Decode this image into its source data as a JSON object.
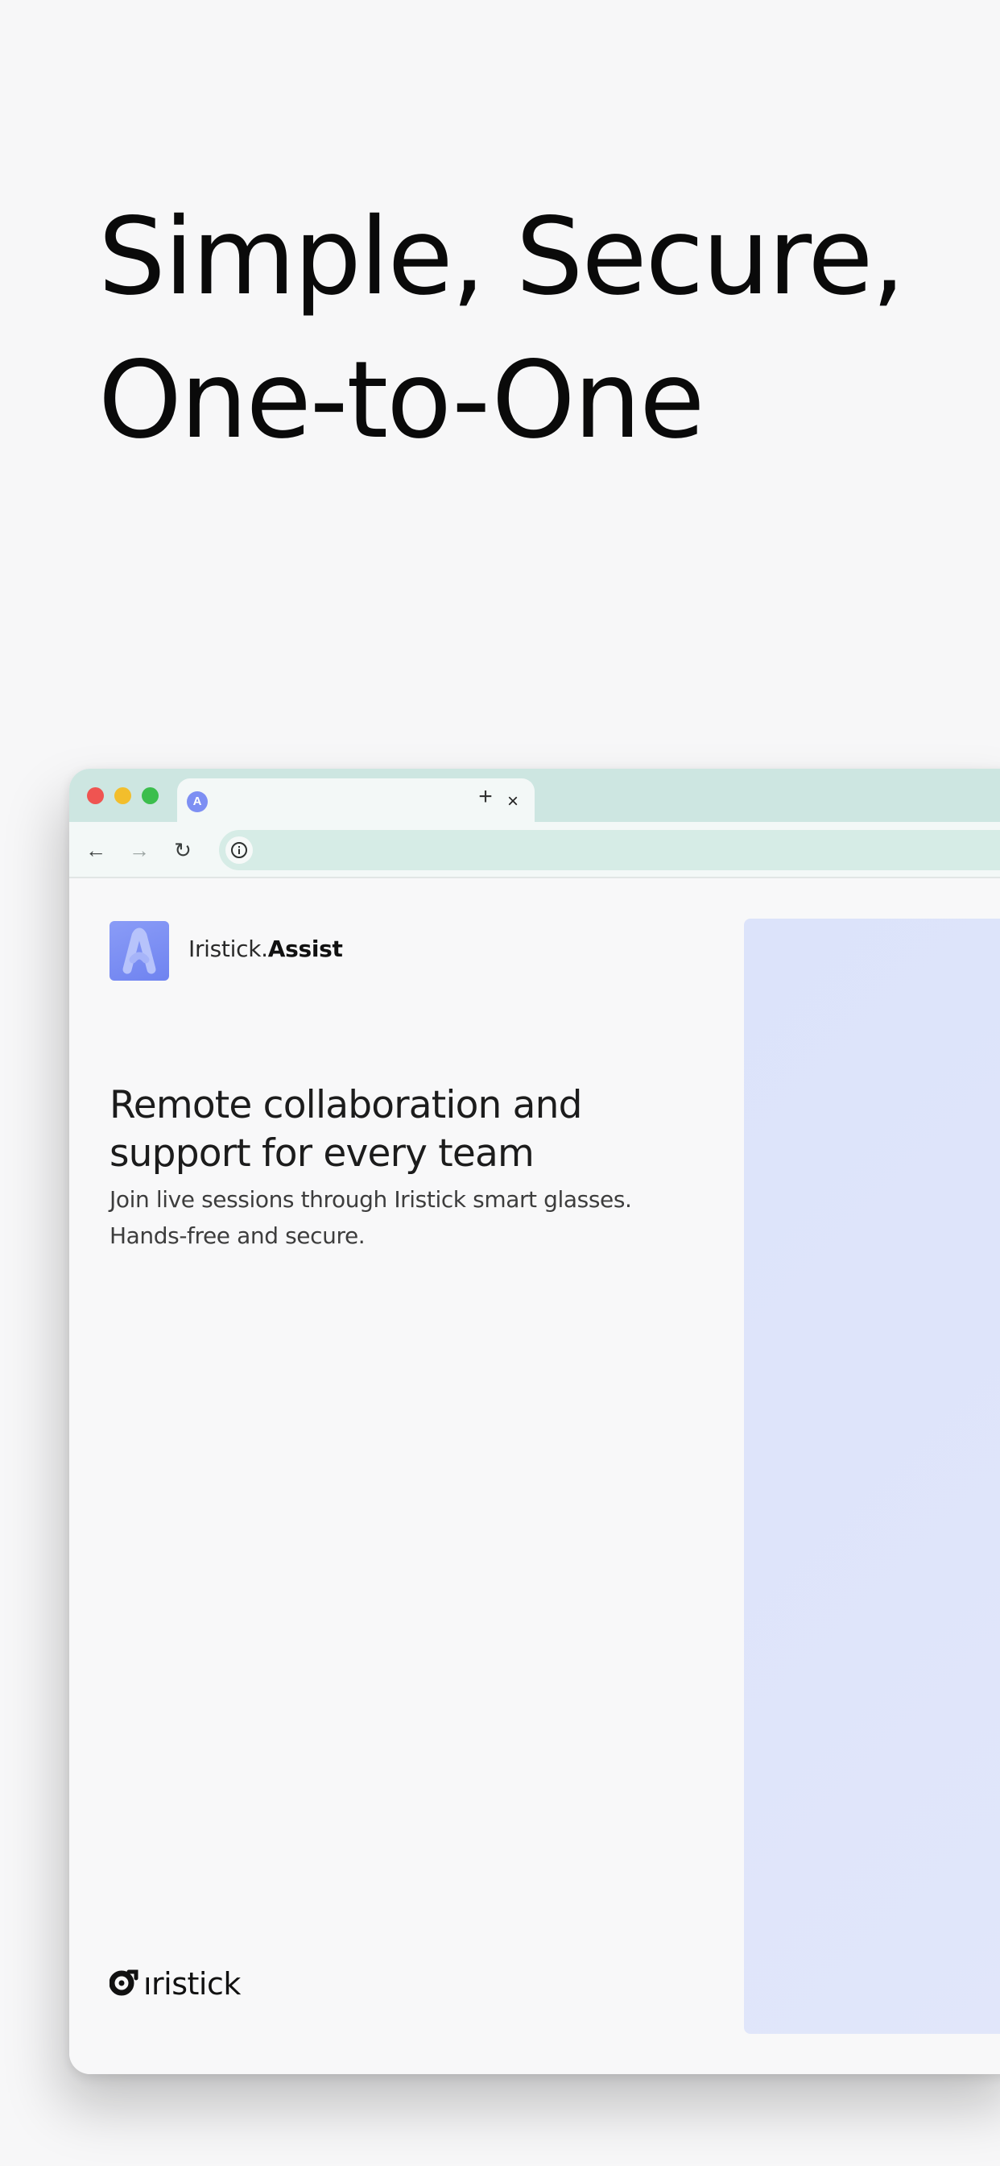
{
  "hero": {
    "title_line1": "Simple, Secure,",
    "title_line2": "One-to-One"
  },
  "browser": {
    "tab": {
      "favicon": "A",
      "close_label": "×"
    },
    "new_tab_label": "+",
    "toolbar": {
      "back_icon": "←",
      "forward_icon": "→",
      "reload_icon": "↻"
    }
  },
  "page": {
    "app_name_prefix": "Iristick.",
    "app_name_bold": "Assist",
    "heading": "Remote collaboration and support for every team",
    "subtitle": "Join live sessions through Iristick smart glasses. Hands-free and secure.",
    "footer_brand": "ıristick"
  },
  "colors": {
    "background": "#f7f7f8",
    "tabstrip": "#cde6e1",
    "address_bar": "#d6ece6",
    "accent": "#7d8ff3",
    "hero_panel": "#dce3fa",
    "traffic_red": "#ef5451",
    "traffic_yellow": "#f2be2c",
    "traffic_green": "#3bbe4d"
  },
  "icons": [
    "traffic-light-close-icon",
    "traffic-light-minimize-icon",
    "traffic-light-zoom-icon",
    "favicon-icon",
    "close-icon",
    "plus-icon",
    "back-arrow-icon",
    "forward-arrow-icon",
    "reload-icon",
    "info-icon",
    "app-logo-icon",
    "iristick-logo-icon"
  ]
}
